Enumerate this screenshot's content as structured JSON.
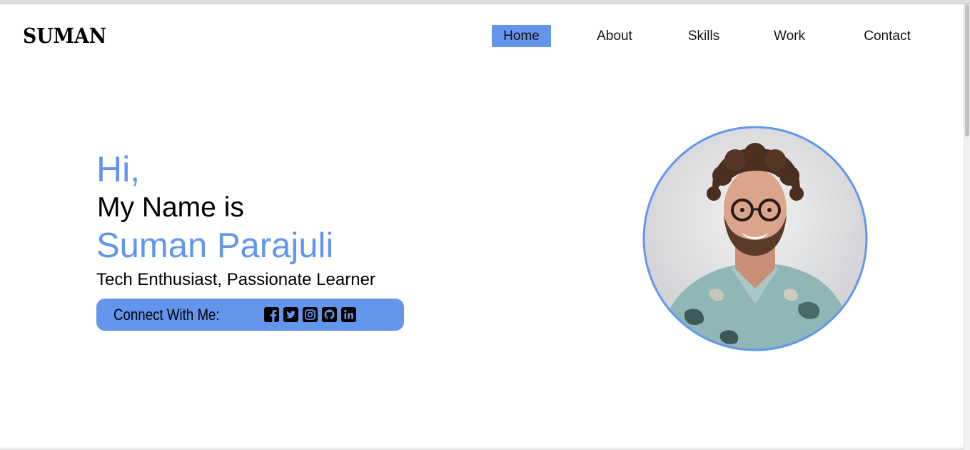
{
  "header": {
    "logo": "SUMAN",
    "nav": [
      {
        "label": "Home",
        "active": true
      },
      {
        "label": "About",
        "active": false
      },
      {
        "label": "Skills",
        "active": false
      },
      {
        "label": "Work",
        "active": false
      },
      {
        "label": "Contact",
        "active": false
      }
    ]
  },
  "hero": {
    "greeting": "Hi,",
    "intro": "My Name is",
    "name": "Suman Parajuli",
    "tagline": "Tech Enthusiast, Passionate Learner",
    "connect": {
      "label": "Connect With Me:",
      "icons": [
        "facebook-icon",
        "twitter-icon",
        "instagram-icon",
        "github-icon",
        "linkedin-icon"
      ]
    }
  },
  "theme": {
    "accent": "#6495ed",
    "text": "#000000",
    "background": "#ffffff"
  }
}
